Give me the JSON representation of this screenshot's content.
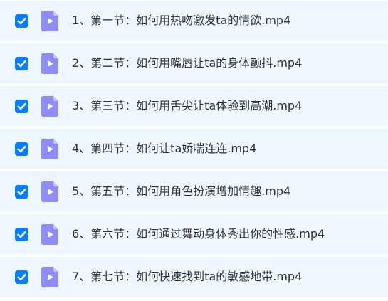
{
  "colors": {
    "row_background": "#eef6ff",
    "checkbox_fill": "#0a7cff",
    "video_icon_fill": "#8e8cf8",
    "video_icon_fold": "#c8c6fd",
    "text": "#333333"
  },
  "icons": {
    "checkbox": "checkbox-checked-icon",
    "file": "video-file-icon"
  },
  "files": [
    {
      "name": "1、第一节：如何用热吻激发ta的情欲.mp4",
      "checked": true
    },
    {
      "name": "2、第二节：如何用嘴唇让ta的身体颤抖.mp4",
      "checked": true
    },
    {
      "name": "3、第三节：如何用舌尖让ta体验到高潮.mp4",
      "checked": true
    },
    {
      "name": "4、第四节：如何让ta娇喘连连.mp4",
      "checked": true
    },
    {
      "name": "5、第五节：如何用角色扮演增加情趣.mp4",
      "checked": true
    },
    {
      "name": "6、第六节：如何通过舞动身体秀出你的性感.mp4",
      "checked": true
    },
    {
      "name": "7、第七节：如何快速找到ta的敏感地带.mp4",
      "checked": true
    }
  ]
}
